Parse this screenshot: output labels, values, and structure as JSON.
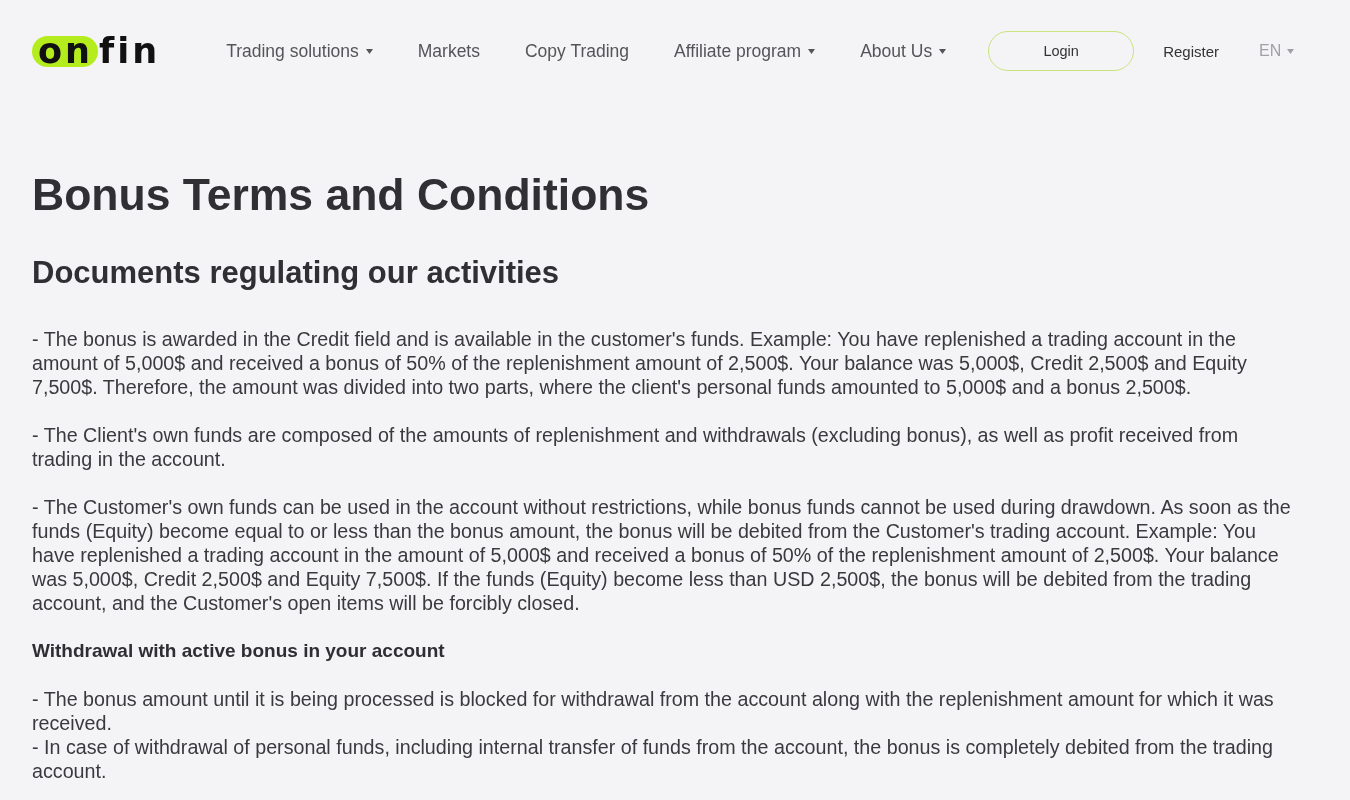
{
  "logo": {
    "part_1": "on",
    "part_2": "fin"
  },
  "nav": [
    {
      "label": "Trading solutions",
      "dropdown": true
    },
    {
      "label": "Markets",
      "dropdown": false
    },
    {
      "label": "Copy Trading",
      "dropdown": false
    },
    {
      "label": "Affiliate program",
      "dropdown": true
    },
    {
      "label": "About Us",
      "dropdown": true
    }
  ],
  "login_button": "Login",
  "register_link": "Register",
  "language": {
    "label": "EN",
    "dropdown": true
  },
  "title": "Bonus Terms and Conditions",
  "subtitle": "Documents regulating our activities",
  "blocks": [
    {
      "kind": "paragraph",
      "items": [
        "- The bonus is awarded in the Credit field and is available in the customer's funds. Example: You have replenished a trading account in the amount of 5,000$ and received a bonus of 50% of the replenishment amount of 2,500$. Your balance was 5,000$, Credit 2,500$ and Equity 7,500$. Therefore, the amount was divided into two parts, where the client's personal funds amounted to 5,000$ and a bonus 2,500$."
      ]
    },
    {
      "kind": "paragraph",
      "items": [
        "- The Client's own funds are composed of the amounts of replenishment and withdrawals (excluding bonus), as well as profit received from trading in the account."
      ]
    },
    {
      "kind": "paragraph",
      "items": [
        "- The Customer's own funds can be used in the account without restrictions, while bonus funds cannot be used during drawdown. As soon as the funds (Equity) become equal to or less than the bonus amount, the bonus will be debited from the Customer's trading account. Example: You have replenished a trading account in the amount of 5,000$ and received a bonus of 50% of the replenishment amount of 2,500$. Your balance was 5,000$, Credit 2,500$ and Equity 7,500$. If the funds (Equity) become less than USD 2,500$, the bonus will be debited from the trading account, and the Customer's open items will be forcibly closed."
      ]
    },
    {
      "kind": "heading",
      "items": [
        "Withdrawal with active bonus in your account"
      ]
    },
    {
      "kind": "paragraph",
      "items": [
        "- The bonus amount until it is being processed is blocked for withdrawal from the account along with the replenishment amount for which it was received.",
        "- In case of withdrawal of personal funds, including internal transfer of funds from the account, the bonus is completely debited from the trading account."
      ]
    }
  ]
}
